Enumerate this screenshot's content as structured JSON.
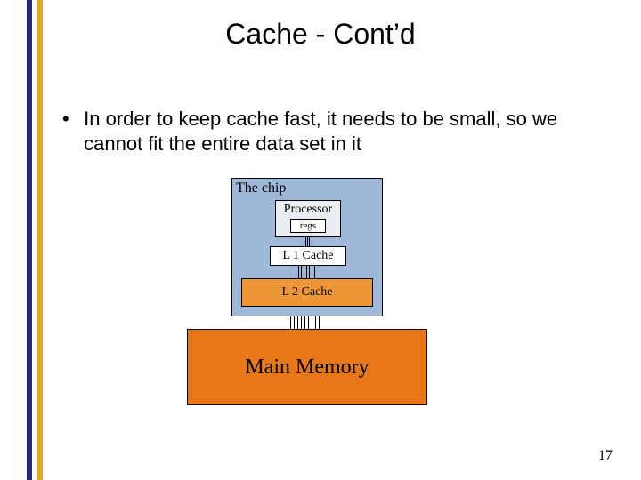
{
  "title": "Cache - Cont’d",
  "bullet": "In order to keep cache fast, it needs to be small, so we cannot fit the entire data set in it",
  "diagram": {
    "chip_label": "The chip",
    "processor_label": "Processor",
    "regs_label": "regs",
    "l1_label": "L 1 Cache",
    "l2_label": "L 2 Cache",
    "main_memory_label": "Main Memory"
  },
  "page_number": "17"
}
